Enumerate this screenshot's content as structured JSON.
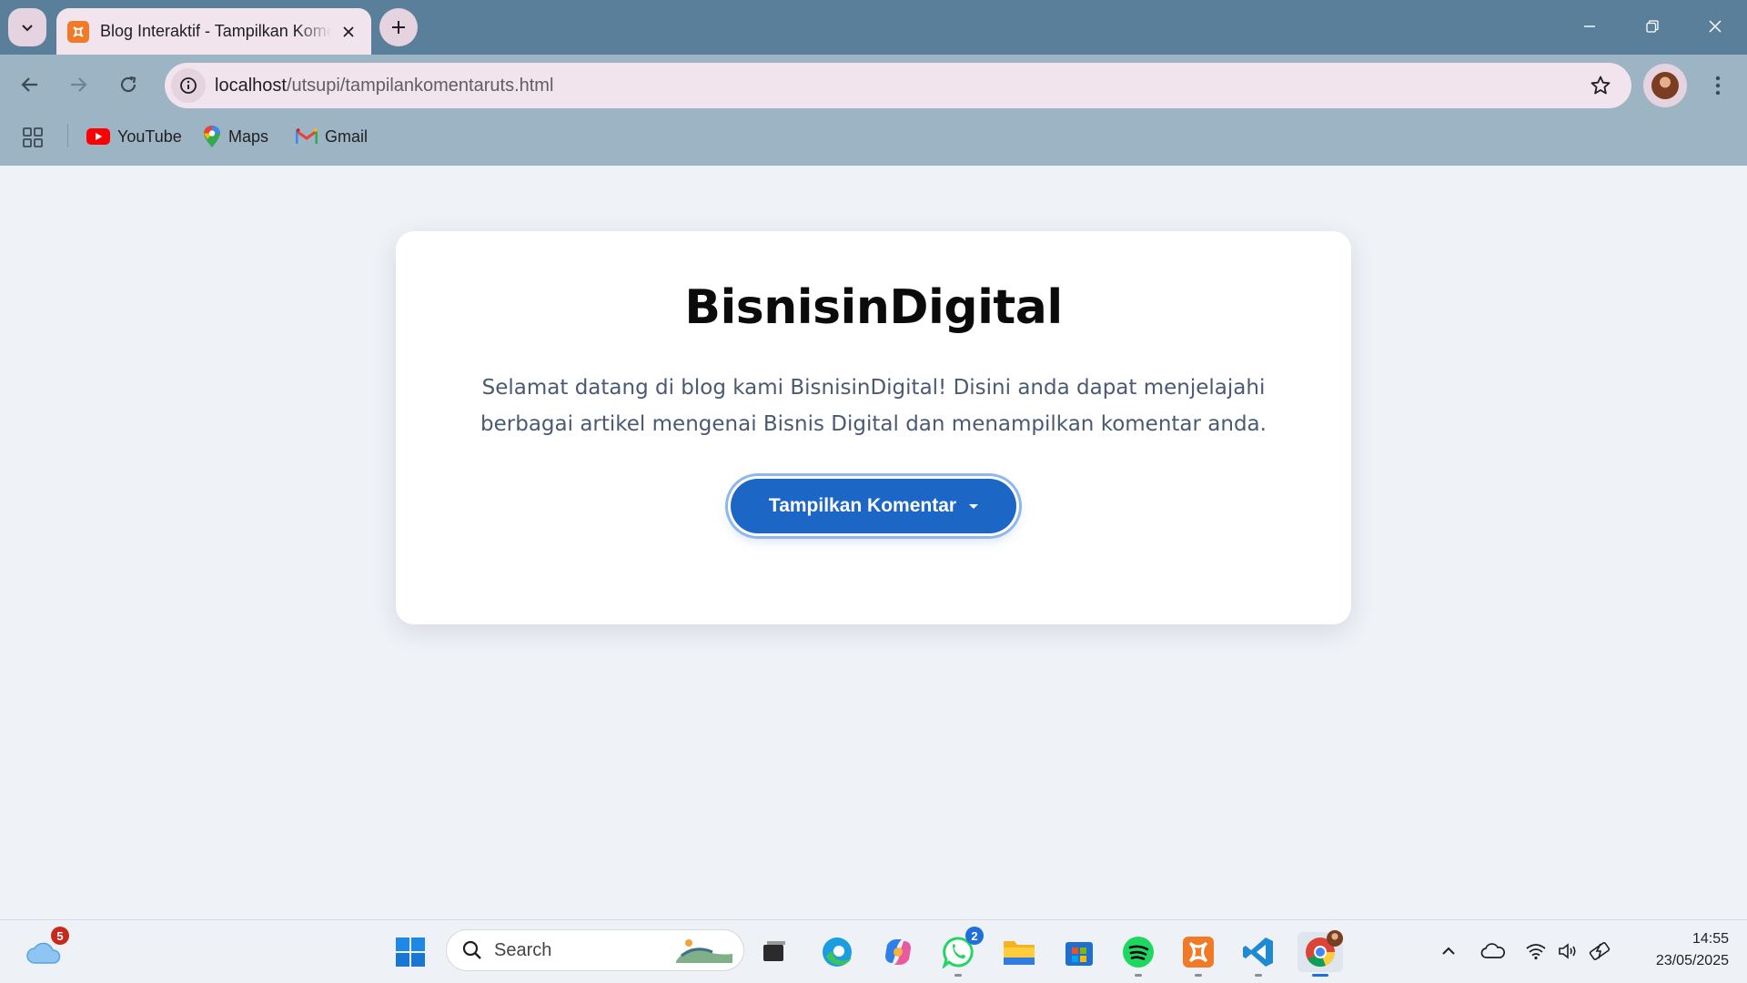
{
  "browser": {
    "tab_title": "Blog Interaktif - Tampilkan Komentar",
    "url_host": "localhost",
    "url_path": "/utsupi/tampilankomentaruts.html",
    "bookmarks": [
      "YouTube",
      "Maps",
      "Gmail"
    ]
  },
  "page": {
    "title": "BisnisinDigital",
    "intro": "Selamat datang di blog kami BisnisinDigital! Disini anda dapat menjelajahi berbagai artikel mengenai Bisnis Digital dan menampilkan komentar anda.",
    "button_label": "Tampilkan Komentar"
  },
  "taskbar": {
    "weather_badge": "5",
    "search_placeholder": "Search",
    "whatsapp_badge": "2",
    "time": "14:55",
    "date": "23/05/2025"
  },
  "colors": {
    "titlebar": "#5a7f9b",
    "toolbar": "#9db4c5",
    "page_bg": "#eff2f6",
    "button": "#1c66c6"
  }
}
